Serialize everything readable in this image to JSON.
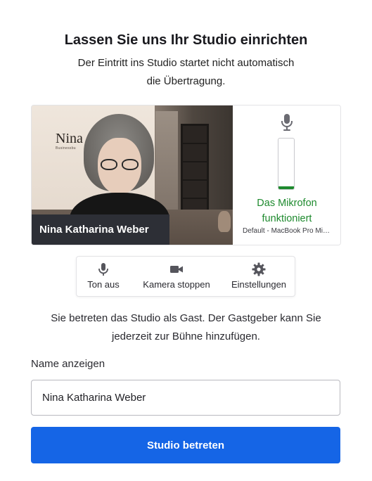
{
  "header": {
    "title": "Lassen Sie uns Ihr Studio einrichten",
    "subtitle_line1": "Der Eintritt ins Studio startet nicht automatisch",
    "subtitle_line2": "die Übertragung."
  },
  "preview": {
    "participant_name": "Nina Katharina Weber",
    "wall_sign": "Nina",
    "mic": {
      "icon": "microphone-icon",
      "level": 0.05,
      "status_line1": "Das Mikrofon",
      "status_line2": "funktioniert",
      "device": "Default - MacBook Pro Microphone",
      "status_color": "#1e8a2e"
    }
  },
  "controls": [
    {
      "icon": "microphone-icon",
      "label": "Ton aus"
    },
    {
      "icon": "video-camera-icon",
      "label": "Kamera stoppen"
    },
    {
      "icon": "gear-icon",
      "label": "Einstellungen"
    }
  ],
  "info": {
    "line1": "Sie betreten das Studio als Gast. Der Gastgeber kann Sie",
    "line2": "jederzeit zur Bühne hinzufügen."
  },
  "form": {
    "display_name_label": "Name anzeigen",
    "display_name_value": "Nina Katharina Weber",
    "submit_label": "Studio betreten"
  },
  "colors": {
    "accent": "#1565e6",
    "success": "#1e8a2e",
    "name_tag_bg": "#2d2f36"
  }
}
